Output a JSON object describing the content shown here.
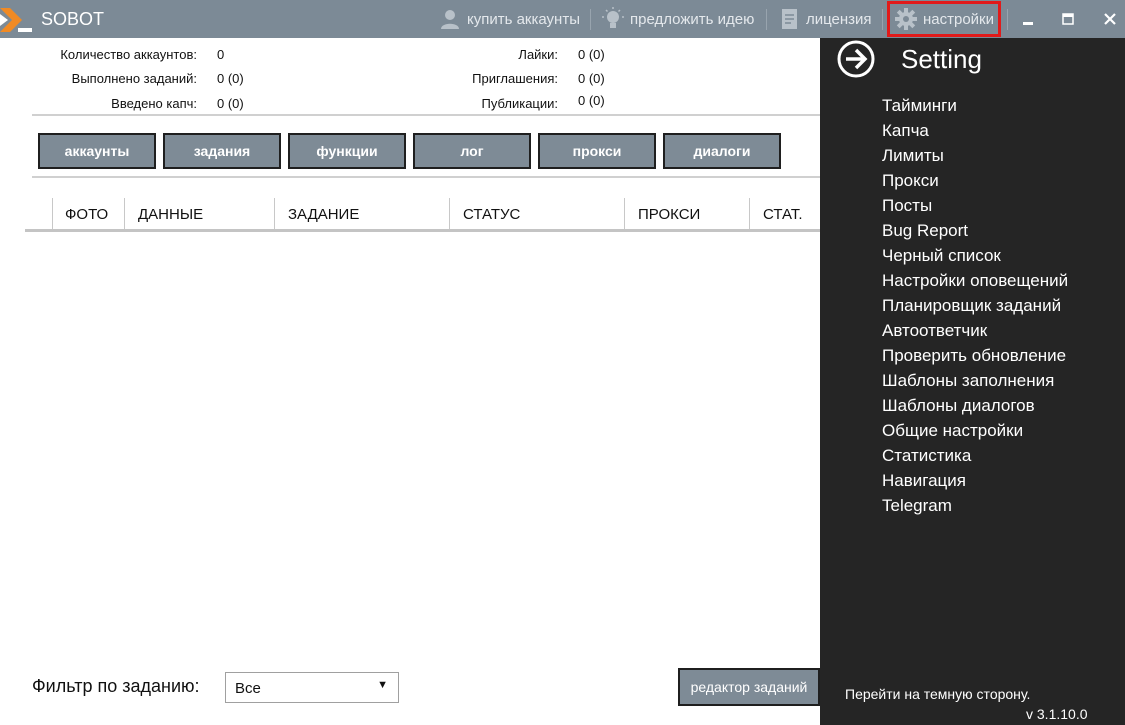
{
  "app": {
    "title": "SOBOT"
  },
  "titlebar": {
    "buy_accounts": "купить аккаунты",
    "suggest_idea": "предложить идею",
    "license": "лицензия",
    "settings": "настройки"
  },
  "stats": {
    "accounts_label": "Количество аккаунтов:",
    "accounts_value": "0",
    "tasks_done_label": "Выполнено заданий:",
    "tasks_done_value": "0 (0)",
    "captcha_label": "Введено капч:",
    "captcha_value": "0 (0)",
    "likes_label": "Лайки:",
    "likes_value": "0 (0)",
    "invites_label": "Приглашения:",
    "invites_value": "0 (0)",
    "posts_label": "Публикации:",
    "posts_value": "0 (0)"
  },
  "tabs": [
    "аккаунты",
    "задания",
    "функции",
    "лог",
    "прокси",
    "диалоги"
  ],
  "table": {
    "columns": [
      "ФОТО",
      "ДАННЫЕ",
      "ЗАДАНИЕ",
      "СТАТУС",
      "ПРОКСИ",
      "СТАТ."
    ]
  },
  "filter": {
    "label": "Фильтр по заданию:",
    "value": "Все"
  },
  "editor_button": "редактор заданий",
  "settings_panel": {
    "title": "Setting",
    "items": [
      "Тайминги",
      "Капча",
      "Лимиты",
      "Прокси",
      "Посты",
      "Bug Report",
      "Черный список",
      "Настройки оповещений",
      "Планировщик заданий",
      "Автоответчик",
      "Проверить обновление",
      "Шаблоны заполнения",
      "Шаблоны диалогов",
      "Общие настройки",
      "Статистика",
      "Навигация",
      "Telegram"
    ],
    "dark_side": "Перейти на темную сторону.",
    "version": "v 3.1.10.0"
  },
  "colors": {
    "titlebar": "#7c8a96",
    "button": "#7e8b96",
    "panel": "#252525",
    "logo_accent": "#f08a24",
    "highlight": "#e11a1a"
  }
}
